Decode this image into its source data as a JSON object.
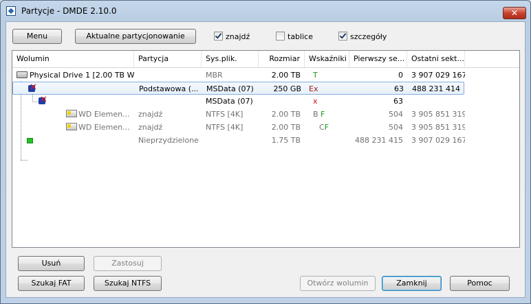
{
  "window": {
    "title": "Partycje - DMDE 2.10.0",
    "close": "✕"
  },
  "toolbar": {
    "menu": "Menu",
    "current": "Aktualne partycjonowanie",
    "find": "znajdź",
    "tables": "tablice",
    "details": "szczegóły"
  },
  "columns": [
    "Wolumin",
    "Partycja",
    "Sys.plik.",
    "Rozmiar",
    "Wskaźniki",
    "Pierwszy se...",
    "Ostatni sekt..."
  ],
  "rows": [
    {
      "volume": "Physical Drive 1 [2.00 TB W...",
      "partition": "",
      "fs": "MBR",
      "size": "2.00 TB",
      "flags": "T",
      "first": "0",
      "last": "3 907 029 167"
    },
    {
      "volume": "",
      "partition": "Podstawowa (...",
      "fs": "MSData (07)",
      "size": "250 GB",
      "flags": "Ex",
      "first": "63",
      "last": "488 231 414"
    },
    {
      "volume": "",
      "partition": "",
      "fs": "MSData (07)",
      "size": "",
      "flags": "x",
      "first": "63",
      "last": ""
    },
    {
      "volume": "WD Elemen...",
      "partition": "znajdź",
      "fs": "NTFS [4K]",
      "size": "2.00 TB",
      "flags": "B F",
      "first": "504",
      "last": "3 905 851 319"
    },
    {
      "volume": "WD Elemen...",
      "partition": "znajdź",
      "fs": "NTFS [4K]",
      "size": "2.00 TB",
      "flags": "CF",
      "first": "504",
      "last": "3 905 851 319"
    },
    {
      "volume": "",
      "partition": "Nieprzydzielone",
      "fs": "",
      "size": "1.75 TB",
      "flags": "",
      "first": "488 231 415",
      "last": "3 907 029 167"
    }
  ],
  "buttons": {
    "delete": "Usuń",
    "apply": "Zastosuj",
    "search_fat": "Szukaj FAT",
    "search_ntfs": "Szukaj NTFS",
    "open_volume": "Otwórz wolumin",
    "close": "Zamknij",
    "help": "Pomoc"
  }
}
